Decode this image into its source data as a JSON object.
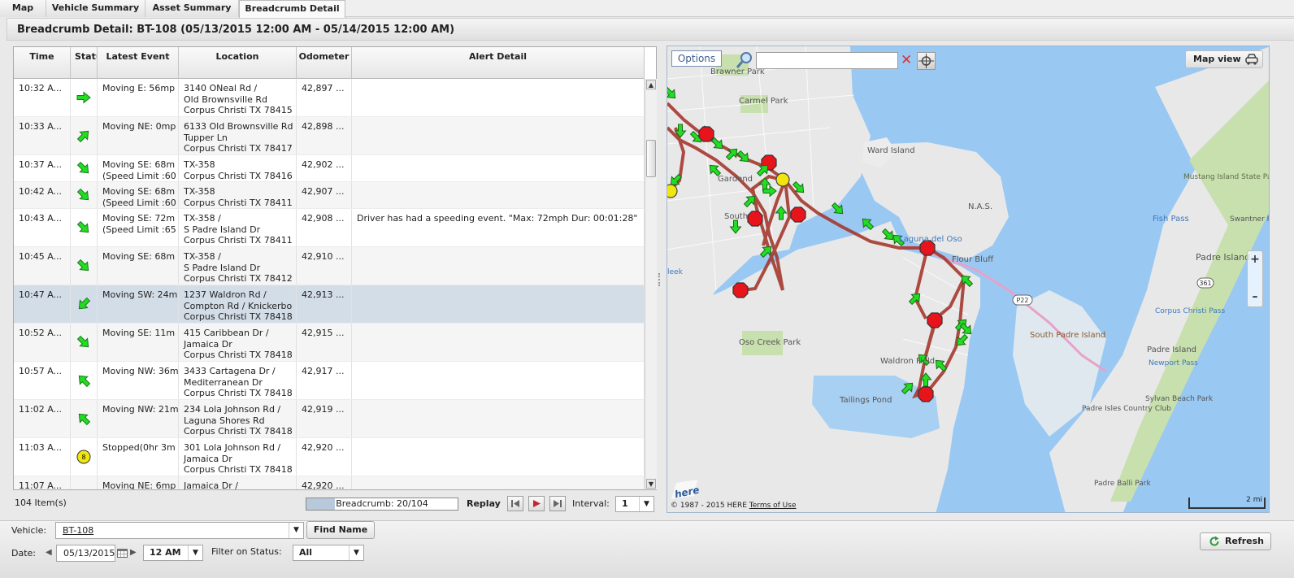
{
  "tabs": [
    {
      "label": "Map"
    },
    {
      "label": "Vehicle Summary"
    },
    {
      "label": "Asset Summary"
    },
    {
      "label": "Breadcrumb Detail"
    }
  ],
  "header": {
    "title": "Breadcrumb Detail: BT-108 (05/13/2015 12:00 AM - 05/14/2015 12:00 AM)"
  },
  "table": {
    "columns": [
      "Time",
      "Status",
      "Latest Event",
      "Location",
      "Odometer",
      "Alert Detail"
    ],
    "rows": [
      {
        "time": "10:32 A...",
        "status": "arrow-e-icon",
        "event1": "Moving E: 56mp",
        "event2": "",
        "loc1": "3140 ONeal Rd /",
        "loc2": "Old Brownsville Rd",
        "loc3": "Corpus Christi TX 78415",
        "odometer": "42,897 ...",
        "alert": ""
      },
      {
        "time": "10:33 A...",
        "status": "arrow-ne-icon",
        "event1": "Moving NE: 0mp",
        "event2": "",
        "loc1": "6133 Old Brownsville Rd",
        "loc2": "Tupper Ln",
        "loc3": "Corpus Christi TX 78417",
        "odometer": "42,898 ...",
        "alert": ""
      },
      {
        "time": "10:37 A...",
        "status": "arrow-se-icon",
        "event1": "Moving SE: 68m",
        "event2": "(Speed Limit :60",
        "loc1": "TX-358",
        "loc2": "Corpus Christi TX 78416",
        "loc3": "",
        "odometer": "42,902 ...",
        "alert": ""
      },
      {
        "time": "10:42 A...",
        "status": "arrow-se-icon",
        "event1": "Moving SE: 68m",
        "event2": "(Speed Limit :60",
        "loc1": "TX-358",
        "loc2": "Corpus Christi TX 78411",
        "loc3": "",
        "odometer": "42,907 ...",
        "alert": ""
      },
      {
        "time": "10:43 A...",
        "status": "arrow-se-icon",
        "event1": "Moving SE: 72m",
        "event2": "(Speed Limit :65",
        "loc1": "TX-358 /",
        "loc2": "S Padre Island Dr",
        "loc3": "Corpus Christi TX 78411",
        "odometer": "42,908 ...",
        "alert": "Driver has had a speeding event. \"Max: 72mph Dur: 00:01:28\""
      },
      {
        "time": "10:45 A...",
        "status": "arrow-se-icon",
        "event1": "Moving SE: 68m",
        "event2": "",
        "loc1": "TX-358 /",
        "loc2": "S Padre Island Dr",
        "loc3": "Corpus Christi TX 78412",
        "odometer": "42,910 ...",
        "alert": ""
      },
      {
        "time": "10:47 A...",
        "status": "arrow-sw-icon",
        "event1": "Moving SW: 24m",
        "event2": "",
        "loc1": "1237 Waldron Rd /",
        "loc2": "Compton Rd / Knickerbo",
        "loc3": "Corpus Christi TX 78418",
        "odometer": "42,913 ...",
        "alert": ""
      },
      {
        "time": "10:52 A...",
        "status": "arrow-se-icon",
        "event1": "Moving SE: 11m",
        "event2": "",
        "loc1": "415 Caribbean Dr /",
        "loc2": "Jamaica Dr",
        "loc3": "Corpus Christi TX 78418",
        "odometer": "42,915 ...",
        "alert": ""
      },
      {
        "time": "10:57 A...",
        "status": "arrow-nw-icon",
        "event1": "Moving NW: 36m",
        "event2": "",
        "loc1": "3433 Cartagena Dr /",
        "loc2": "Mediterranean Dr",
        "loc3": "Corpus Christi TX 78418",
        "odometer": "42,917 ...",
        "alert": ""
      },
      {
        "time": "11:02 A...",
        "status": "arrow-nw-icon",
        "event1": "Moving NW: 21m",
        "event2": "",
        "loc1": "234 Lola Johnson Rd /",
        "loc2": "Laguna Shores Rd",
        "loc3": "Corpus Christi TX 78418",
        "odometer": "42,919 ...",
        "alert": ""
      },
      {
        "time": "11:03 A...",
        "status": "stopped-icon",
        "event1": "Stopped(0hr 3m",
        "event2": "",
        "loc1": "301 Lola Johnson Rd /",
        "loc2": "Jamaica Dr",
        "loc3": "Corpus Christi TX 78418",
        "odometer": "42,920 ...",
        "alert": ""
      },
      {
        "time": "11:07 A...",
        "status": "arrow-ne-icon",
        "event1": "Moving NE: 6mp",
        "event2": "",
        "loc1": "Jamaica Dr /",
        "loc2": "",
        "loc3": "",
        "odometer": "42,920 ...",
        "alert": ""
      }
    ],
    "stopped_badge": "8",
    "selected_row": 6
  },
  "footer": {
    "item_count": "104 Item(s)",
    "breadcrumb_label": "Breadcrumb: 20/104",
    "breadcrumb_progress": 0.19,
    "replay_label": "Replay",
    "interval_label": "Interval:",
    "interval_value": "1"
  },
  "map": {
    "options_label": "Options",
    "search_value": "",
    "view_label": "Map view",
    "zoom_in": "+",
    "zoom_out": "–",
    "copyright": "© 1987 - 2015 HERE",
    "terms": "Terms of Use",
    "scale": "2 mi",
    "logo": "here",
    "places": [
      "Brawner Park",
      "Carmel Park",
      "Ward Island",
      "N.A.S.",
      "Mustang Island State Park",
      "Padre Island",
      "Fish Pass",
      "Swantner Park",
      "Corpus Christi Pass",
      "Flour Bluff",
      "South Padre Island",
      "Oso Creek Park",
      "Waldron Field",
      "Tailings Pond",
      "Padre Isles Country Club",
      "Padre Island",
      "Newport Pass",
      "Sylvan Beach Park",
      "Padre Balli Park",
      "Laguna del Oso",
      "Gardend",
      "South",
      "leek"
    ],
    "road_labels": [
      "P22",
      "361"
    ]
  },
  "filters": {
    "vehicle_label": "Vehicle:",
    "vehicle_value": "BT-108",
    "find_name_label": "Find Name",
    "date_label": "Date:",
    "date_value": "05/13/2015",
    "time_value": "12 AM",
    "status_label": "Filter on Status:",
    "status_value": "All",
    "refresh_label": "Refresh"
  },
  "colors": {
    "arrow_green": "#22dd22",
    "stop_red": "#e8141b",
    "idle_yellow": "#f2e60f",
    "route": "#a5392f",
    "water": "#99c8f3",
    "land": "#eaeaea",
    "park": "#c8dfae",
    "selected_row": "#d3dde8"
  }
}
